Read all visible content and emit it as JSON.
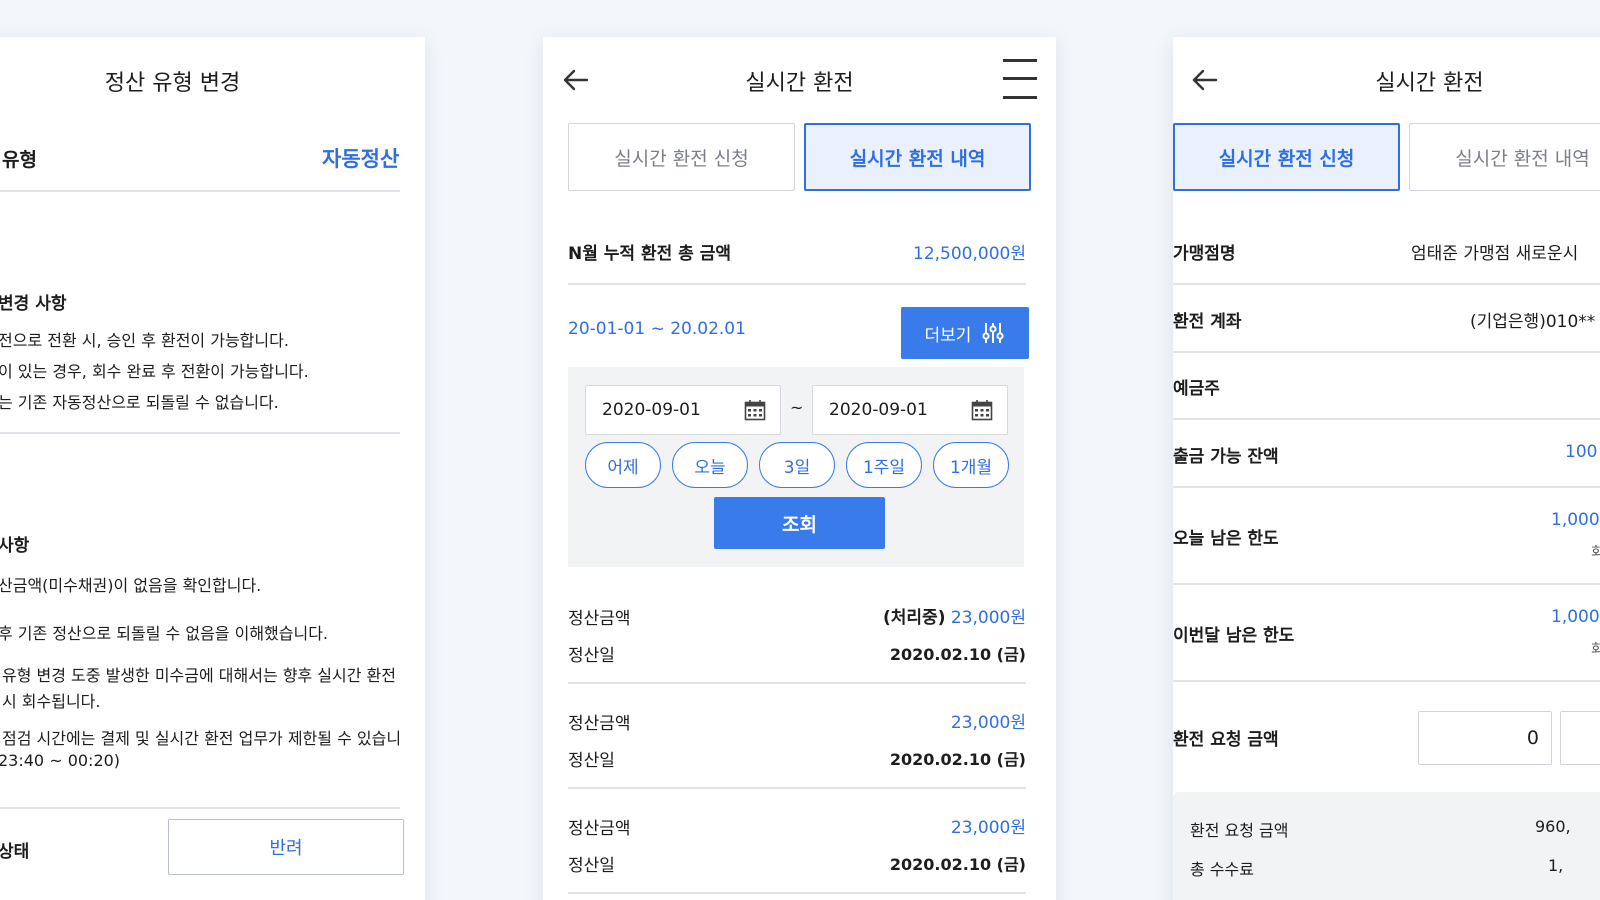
{
  "colors": {
    "accent": "#2f6fe0",
    "accent_solid": "#3a7bec",
    "page_bg": "#f3f6fb"
  },
  "headline_partial": "",
  "panel1": {
    "title": "정산 유형 변경",
    "type_label": "유형",
    "type_value": "자동정산",
    "section1_title": "변경 사항",
    "section1_lines": [
      "전으로 전환 시, 승인 후 환전이 가능합니다.",
      "이 있는 경우, 회수 완료 후 전환이 가능합니다.",
      "는 기존 자동정산으로 되돌릴 수 없습니다."
    ],
    "section2_title": "사항",
    "section2_lines": [
      "산금액(미수채권)이 없음을 확인합니다.",
      "후 기존 정산으로 되돌릴 수 없음을 이해했습니다.",
      "유형 변경 도중 발생한 미수금에 대해서는 향후 실시간 환전",
      "시 회수됩니다.",
      "점검 시간에는 결제 및 실시간 환전 업무가 제한될 수 있습니",
      "23:40 ~ 00:20)"
    ],
    "status_label": "상태",
    "status_button": "반려"
  },
  "panel2": {
    "title": "실시간 환전",
    "tabs": [
      "실시간 환전 신청",
      "실시간 환전 내역"
    ],
    "total_label": "N월 누적 환전 총 금액",
    "total_value": "12,500,000원",
    "range_text": "20-01-01 ~ 20.02.01",
    "more_button": "더보기",
    "date_from": "2020-09-01",
    "date_tilde": "~",
    "date_to": "2020-09-01",
    "quick_ranges": [
      "어제",
      "오늘",
      "3일",
      "1주일",
      "1개월"
    ],
    "search_button": "조회",
    "records": [
      {
        "amount_label": "정산금액",
        "status": "(처리중)",
        "amount": "23,000원",
        "date_label": "정산일",
        "date": "2020.02.10 (금)"
      },
      {
        "amount_label": "정산금액",
        "status": "",
        "amount": "23,000원",
        "date_label": "정산일",
        "date": "2020.02.10 (금)"
      },
      {
        "amount_label": "정산금액",
        "status": "",
        "amount": "23,000원",
        "date_label": "정산일",
        "date": "2020.02.10 (금)"
      }
    ]
  },
  "panel3": {
    "title": "실시간 환전",
    "tabs": [
      "실시간 환전 신청",
      "실시간 환전 내역"
    ],
    "rows": {
      "store_label": "가맹점명",
      "store_value": "엄태준 가맹점 새로운시",
      "account_label": "환전 계좌",
      "account_value": "(기업은행)010**",
      "holder_label": "예금주",
      "balance_label": "출금 가능 잔액",
      "balance_value": "100",
      "today_label": "오늘 남은 한도",
      "today_value": "1,000",
      "today_sub": "회",
      "month_label": "이번달 남은 한도",
      "month_value": "1,000",
      "month_sub": "회",
      "request_label": "환전 요청 금액",
      "request_input": "0"
    },
    "summary": {
      "req_label": "환전 요청 금액",
      "req_value": "960,",
      "fee_label": "총 수수료",
      "fee_value": "1,"
    }
  }
}
